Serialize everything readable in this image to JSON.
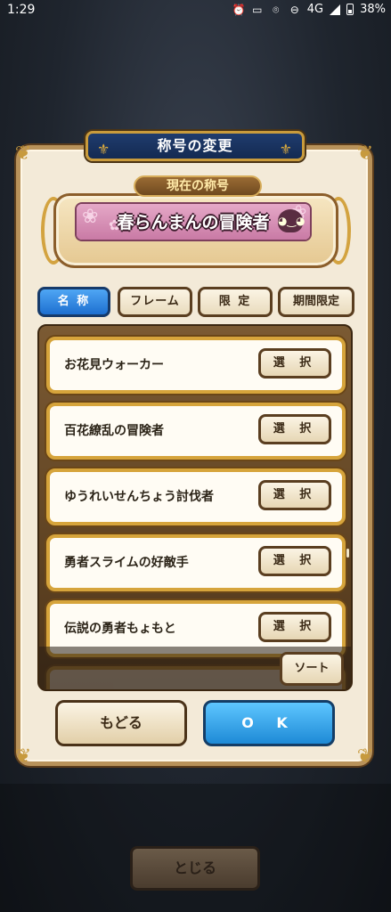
{
  "status_bar": {
    "time": "1:29",
    "network": "4G",
    "battery": "38%"
  },
  "dialog": {
    "title": "称号の変更",
    "current_label": "現在の称号",
    "current_title": "春らんまんの冒険者"
  },
  "tabs": [
    {
      "label": "名 称",
      "active": true
    },
    {
      "label": "フレーム",
      "active": false
    },
    {
      "label": "限 定",
      "active": false
    },
    {
      "label": "期間限定",
      "active": false
    }
  ],
  "titles": [
    {
      "name": "お花見ウォーカー",
      "button": "選 択"
    },
    {
      "name": "百花繚乱の冒険者",
      "button": "選 択"
    },
    {
      "name": "ゆうれいせんちょう討伐者",
      "button": "選 択"
    },
    {
      "name": "勇者スライムの好敵手",
      "button": "選 択"
    },
    {
      "name": "伝説の勇者もょもと",
      "button": "選 択"
    }
  ],
  "sort_label": "ソート",
  "back_label": "もどる",
  "ok_label": "O K",
  "close_label": "とじる",
  "colors": {
    "accent_blue": "#1d6fd0",
    "gold_border": "#d6a43b",
    "panel_brown": "#5a3e20"
  }
}
